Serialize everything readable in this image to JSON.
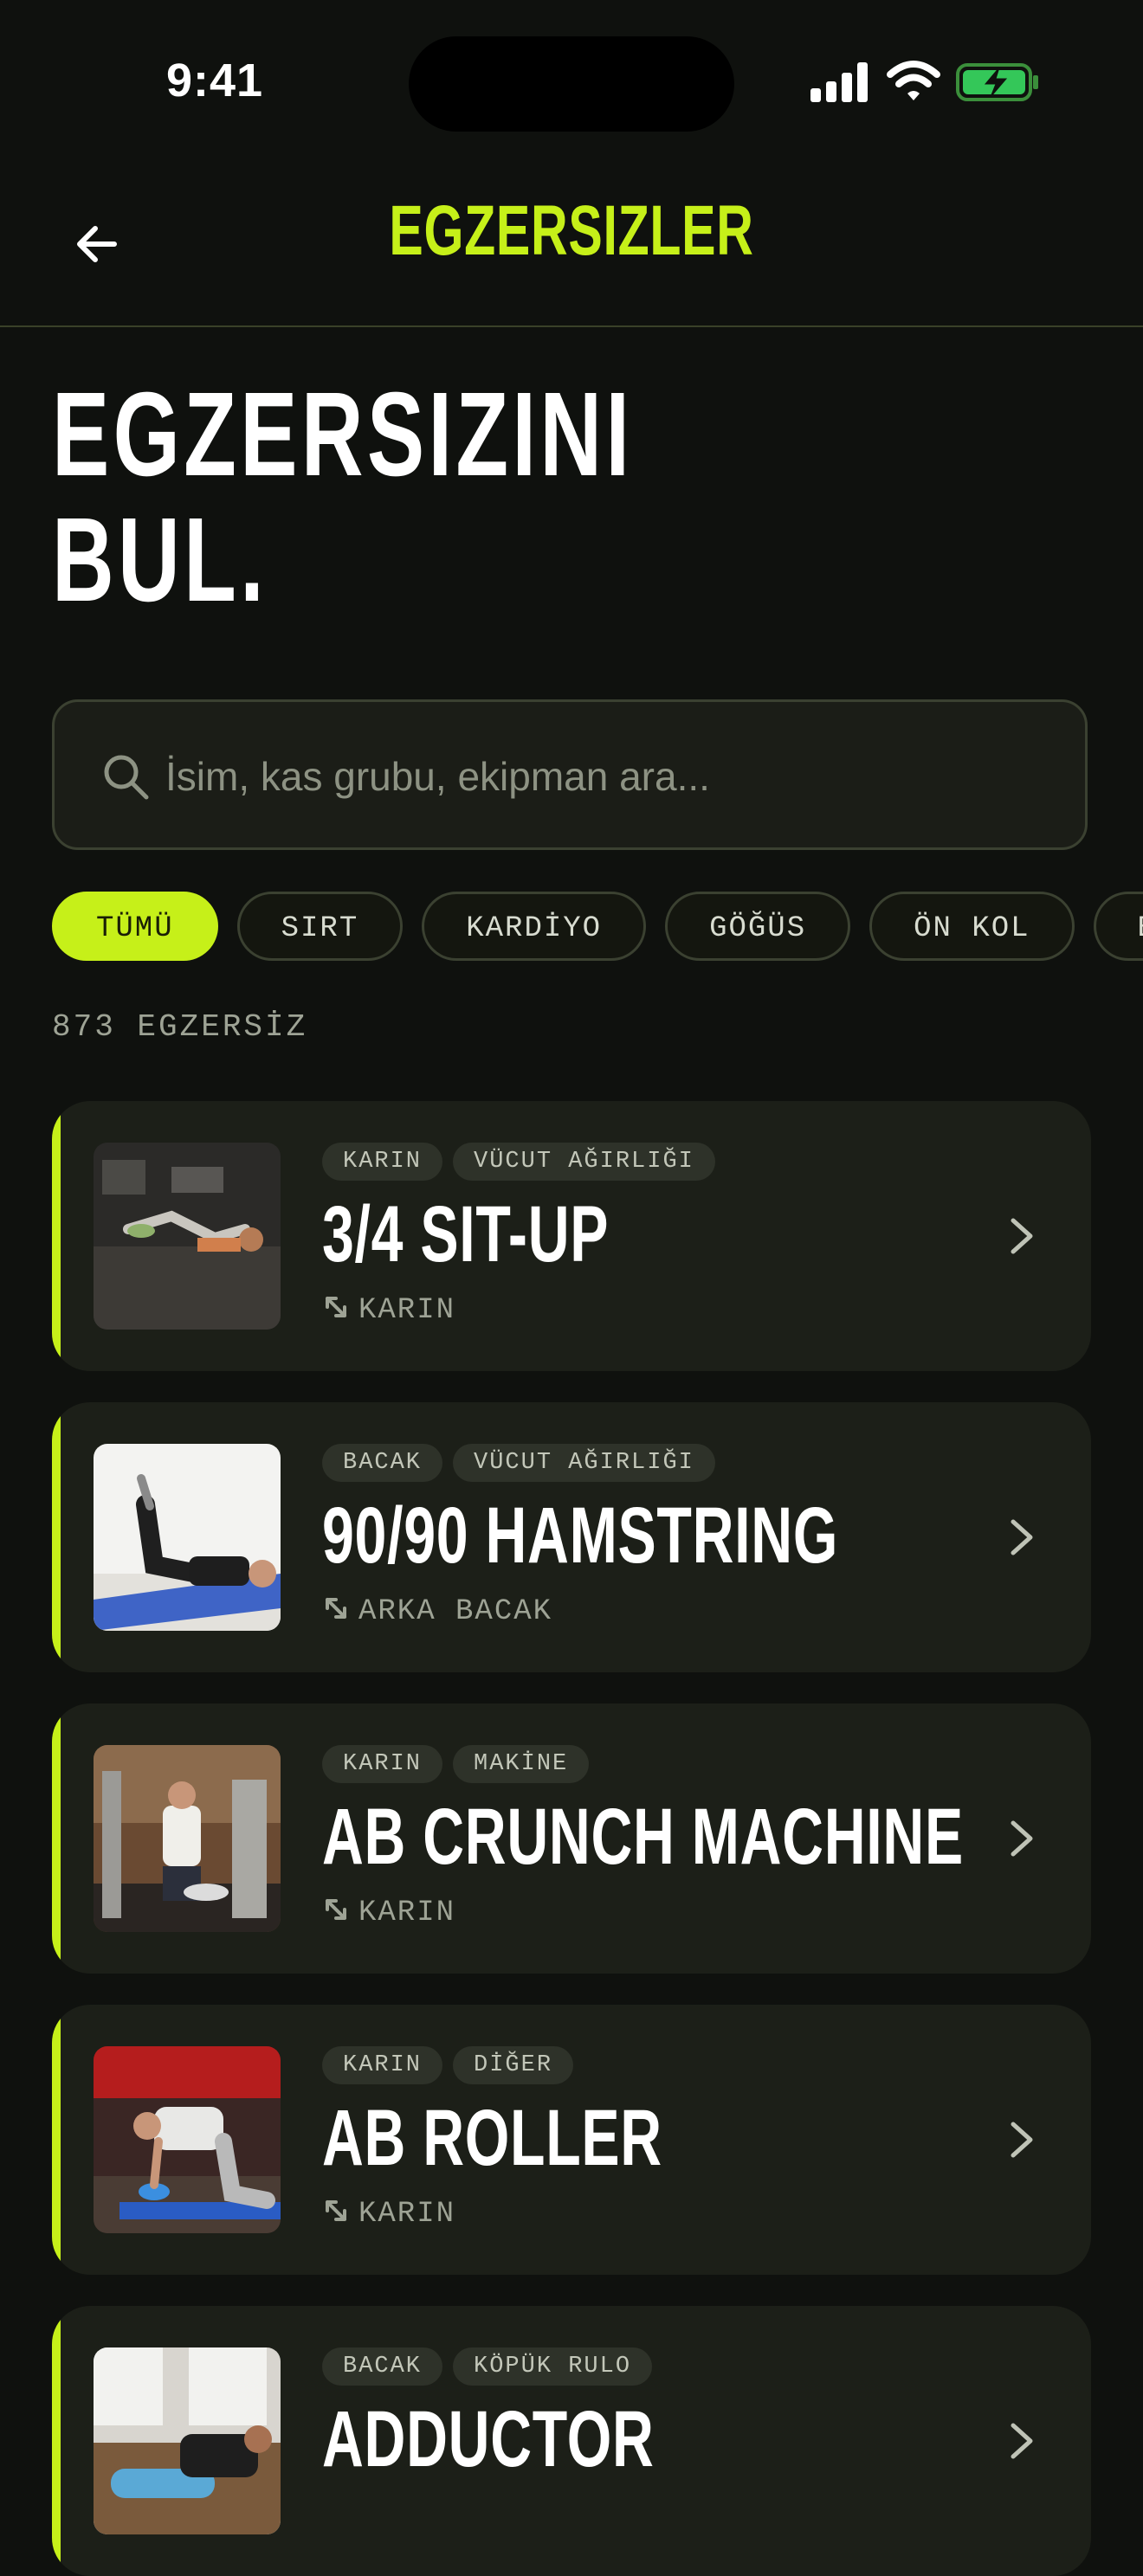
{
  "status": {
    "time": "9:41"
  },
  "nav": {
    "title": "EGZERSIZLER"
  },
  "hero": {
    "line1": "EGZERSIZINI",
    "line2": "BUL."
  },
  "search": {
    "placeholder": "İsim, kas grubu, ekipman ara..."
  },
  "filters": [
    "TÜMÜ",
    "SIRT",
    "KARDİYO",
    "GÖĞÜS",
    "ÖN KOL",
    "B"
  ],
  "active_filter": "TÜMÜ",
  "count_label": "873 EGZERSİZ",
  "exercises": [
    {
      "tags": [
        "KARIN",
        "VÜCUT AĞIRLIĞI"
      ],
      "name": "3/4 SIT-UP",
      "muscle": "KARIN"
    },
    {
      "tags": [
        "BACAK",
        "VÜCUT AĞIRLIĞI"
      ],
      "name": "90/90 HAMSTRING",
      "muscle": "ARKA BACAK"
    },
    {
      "tags": [
        "KARIN",
        "MAKİNE"
      ],
      "name": "AB CRUNCH MACHINE",
      "muscle": "KARIN"
    },
    {
      "tags": [
        "KARIN",
        "DİĞER"
      ],
      "name": "AB ROLLER",
      "muscle": "KARIN"
    },
    {
      "tags": [
        "BACAK",
        "KÖPÜK RULO"
      ],
      "name": "ADDUCTOR",
      "muscle": ""
    }
  ],
  "colors": {
    "accent": "#c6f019",
    "background": "#0f110e",
    "card": "#1c1f18"
  }
}
